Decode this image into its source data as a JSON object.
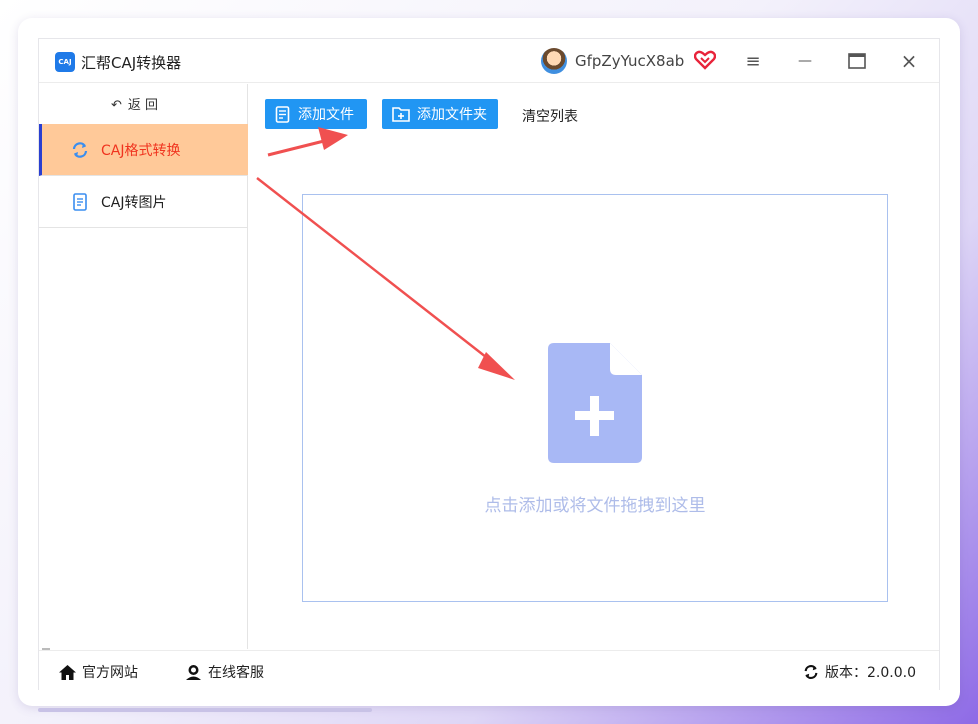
{
  "app": {
    "title": "汇帮CAJ转换器",
    "logo_text": "CAJ",
    "username": "GfpZyYucX8ab"
  },
  "window_controls": {
    "menu": "≡",
    "minimize": "—",
    "maximize": "▭",
    "close": "×"
  },
  "sidebar": {
    "back_label": "返 回",
    "items": [
      {
        "label": "CAJ格式转换",
        "icon": "refresh-icon",
        "active": true
      },
      {
        "label": "CAJ转图片",
        "icon": "document-icon",
        "active": false
      }
    ]
  },
  "toolbar": {
    "add_file_label": "添加文件",
    "add_folder_label": "添加文件夹",
    "clear_label": "清空列表"
  },
  "dropzone": {
    "hint": "点击添加或将文件拖拽到这里"
  },
  "footer": {
    "website_label": "官方网站",
    "support_label": "在线客服",
    "version_label": "版本：2.0.0.0"
  },
  "colors": {
    "accent": "#2196f3",
    "active_bg": "#ffc999",
    "active_text": "#f0341f",
    "arrow": "#f05050",
    "drop_icon": "#a8b8f5"
  }
}
